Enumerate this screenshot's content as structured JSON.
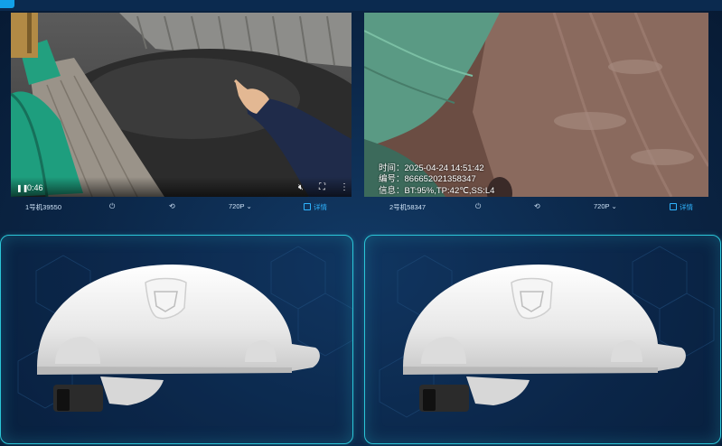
{
  "devices": [
    {
      "id_label": "1号机39550",
      "video": {
        "elapsed": "0:46",
        "play_state": "paused"
      },
      "toolbar": {
        "resolution": "720P",
        "detail_label": "详情"
      }
    },
    {
      "id_label": "2号机58347",
      "video": {
        "osd_time": "时间：2025-04-24 14:51:42",
        "osd_serial": "编号：866652021358347",
        "osd_info": "信息：BT:95%,TP:42℃,SS:L4"
      },
      "toolbar": {
        "resolution": "720P",
        "detail_label": "详情"
      }
    }
  ],
  "colors": {
    "accent": "#2bc6d8",
    "detail_blue": "#2fb4ff",
    "background": "#0b2647"
  },
  "icons": {
    "power": "power-icon",
    "rotate": "rotate-icon",
    "chevron": "chevron-down-icon",
    "detail": "detail-icon",
    "pause": "pause-icon",
    "volume": "volume-off-icon",
    "fullscreen": "fullscreen-icon",
    "more": "more-vertical-icon"
  }
}
